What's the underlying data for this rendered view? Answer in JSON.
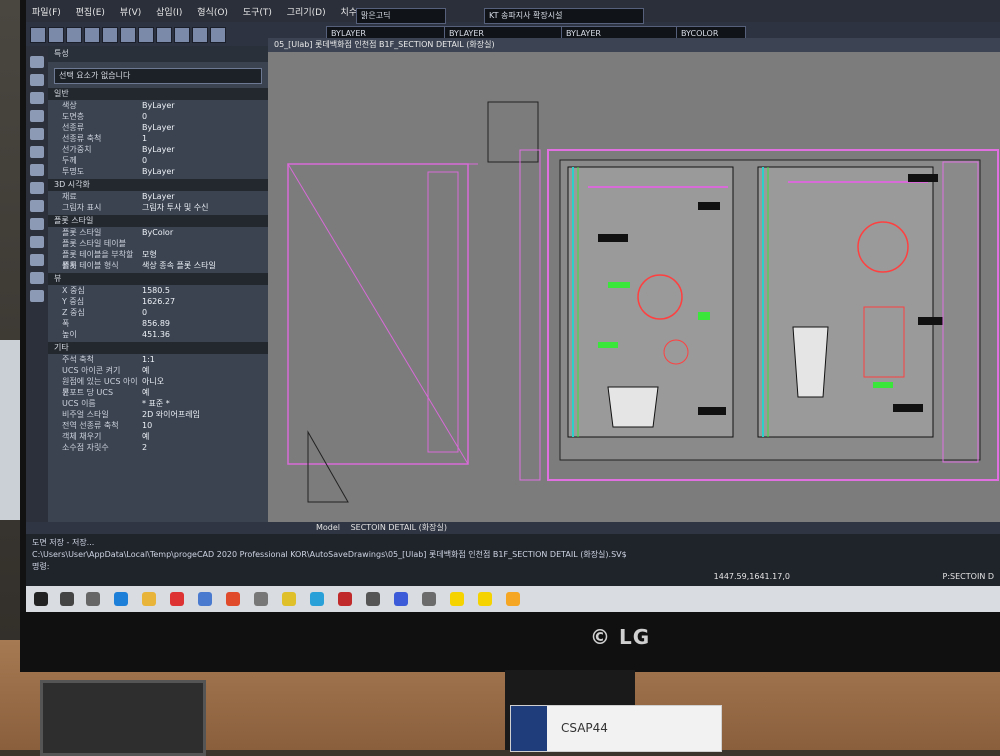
{
  "app": {
    "menu": [
      "파일(F)",
      "편집(E)",
      "뷰(V)",
      "삽입(I)",
      "형식(O)",
      "도구(T)",
      "그리기(D)",
      "치수(N)"
    ],
    "toolbar_dropdowns": {
      "layer": "BYLAYER",
      "font": "맑은고딕",
      "style": "KT 송파지사 확장시설",
      "linetype": "BYLAYER",
      "lineweight": "BYLAYER",
      "color": "BYCOLOR"
    }
  },
  "panel": {
    "title": "특성",
    "selection": "선택 요소가 없습니다",
    "sections": {
      "general": "일반",
      "3d": "3D 시각화",
      "plot": "플롯 스타일",
      "view": "뷰",
      "misc": "기타"
    },
    "general_rows": [
      {
        "k": "색상",
        "v": "ByLayer"
      },
      {
        "k": "도면층",
        "v": "0"
      },
      {
        "k": "선종류",
        "v": "ByLayer"
      },
      {
        "k": "선종류 축척",
        "v": "1"
      },
      {
        "k": "선가중치",
        "v": "ByLayer"
      },
      {
        "k": "두께",
        "v": "0"
      },
      {
        "k": "투명도",
        "v": "ByLayer"
      }
    ],
    "3d_rows": [
      {
        "k": "재료",
        "v": "ByLayer"
      },
      {
        "k": "그림자 표시",
        "v": "그림자 투사 및 수신"
      }
    ],
    "plot_rows": [
      {
        "k": "플롯 스타일",
        "v": "ByColor"
      },
      {
        "k": "플롯 스타일 테이블",
        "v": ""
      },
      {
        "k": "플롯 테이블을 부착할 위치",
        "v": "모형"
      },
      {
        "k": "플롯 테이블 형식",
        "v": "색상 종속 플롯 스타일"
      }
    ],
    "view_rows": [
      {
        "k": "X 중심",
        "v": "1580.5"
      },
      {
        "k": "Y 중심",
        "v": "1626.27"
      },
      {
        "k": "Z 중심",
        "v": "0"
      },
      {
        "k": "폭",
        "v": "856.89"
      },
      {
        "k": "높이",
        "v": "451.36"
      }
    ],
    "misc_rows": [
      {
        "k": "주석 축척",
        "v": "1:1"
      },
      {
        "k": "UCS 아이콘 켜기",
        "v": "예"
      },
      {
        "k": "원점에 있는 UCS 아이콘",
        "v": "아니오"
      },
      {
        "k": "뷰포트 당 UCS",
        "v": "예"
      },
      {
        "k": "UCS 이름",
        "v": "* 표준 *"
      },
      {
        "k": "비주얼 스타일",
        "v": "2D 와이어프레임"
      },
      {
        "k": "전역 선종류 축척",
        "v": "10"
      },
      {
        "k": "객체 채우기",
        "v": "예"
      },
      {
        "k": "소수점 자릿수",
        "v": "2"
      }
    ]
  },
  "drawing_tab": "05_[Ulab] 롯데백화점 인천점 B1F_SECTION DETAIL (화장실)",
  "layout_tabs": [
    "Model",
    "SECTOIN DETAIL (화장실)"
  ],
  "command_lines": [
    "도면 저장 - 저장...",
    "C:\\Users\\User\\AppData\\Local\\Temp\\progeCAD 2020 Professional KOR\\AutoSaveDrawings\\05_[Ulab] 롯데백화점 인천점 B1F_SECTION DETAIL (화장실).SV$",
    "명령:"
  ],
  "coords": "1447.59,1641.17,0",
  "status_right": "P:SECTOIN D",
  "paper_label": "CSAP44"
}
